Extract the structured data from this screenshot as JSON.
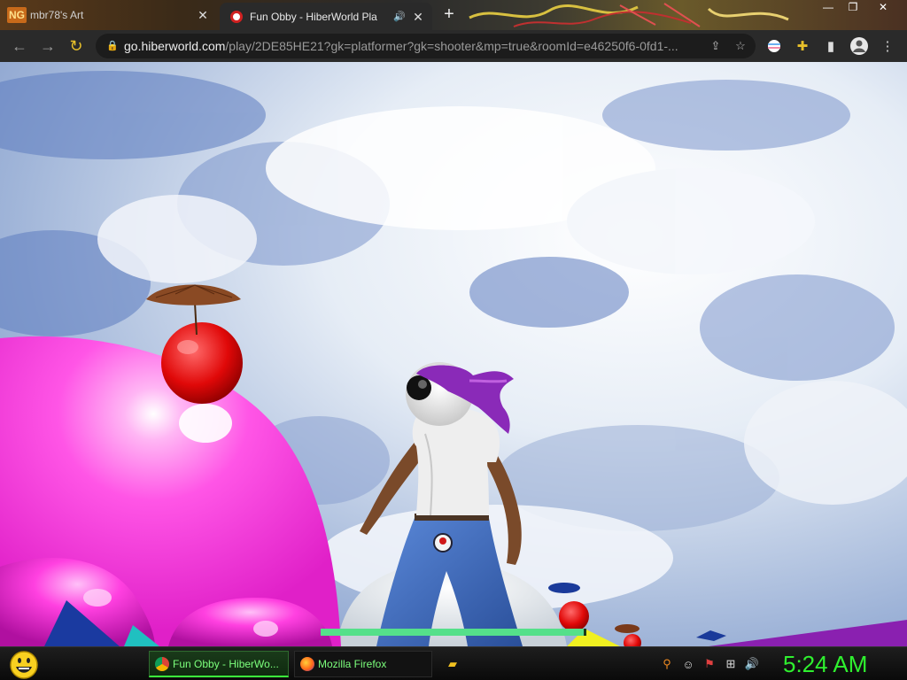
{
  "browser": {
    "tabs": [
      {
        "label": "mbr78's Art",
        "active": false
      },
      {
        "label": "Fun Obby - HiberWorld Pla",
        "active": true
      }
    ],
    "new_tab": "+",
    "url_host": "go.hiberworld.com",
    "url_path": "/play/2DE85HE21?gk=platformer?gk=shooter&mp=true&roomId=e46250f6-0fd1-..."
  },
  "game": {
    "health_fraction": 0.99
  },
  "taskbar": {
    "tasks": [
      {
        "label": "Fun Obby - HiberWo..."
      },
      {
        "label": "Mozilla Firefox"
      }
    ],
    "clock": "5:24 AM"
  },
  "colors": {
    "clock": "#2ff02f",
    "task_text": "#7cff7c",
    "health": "#55e08a"
  }
}
